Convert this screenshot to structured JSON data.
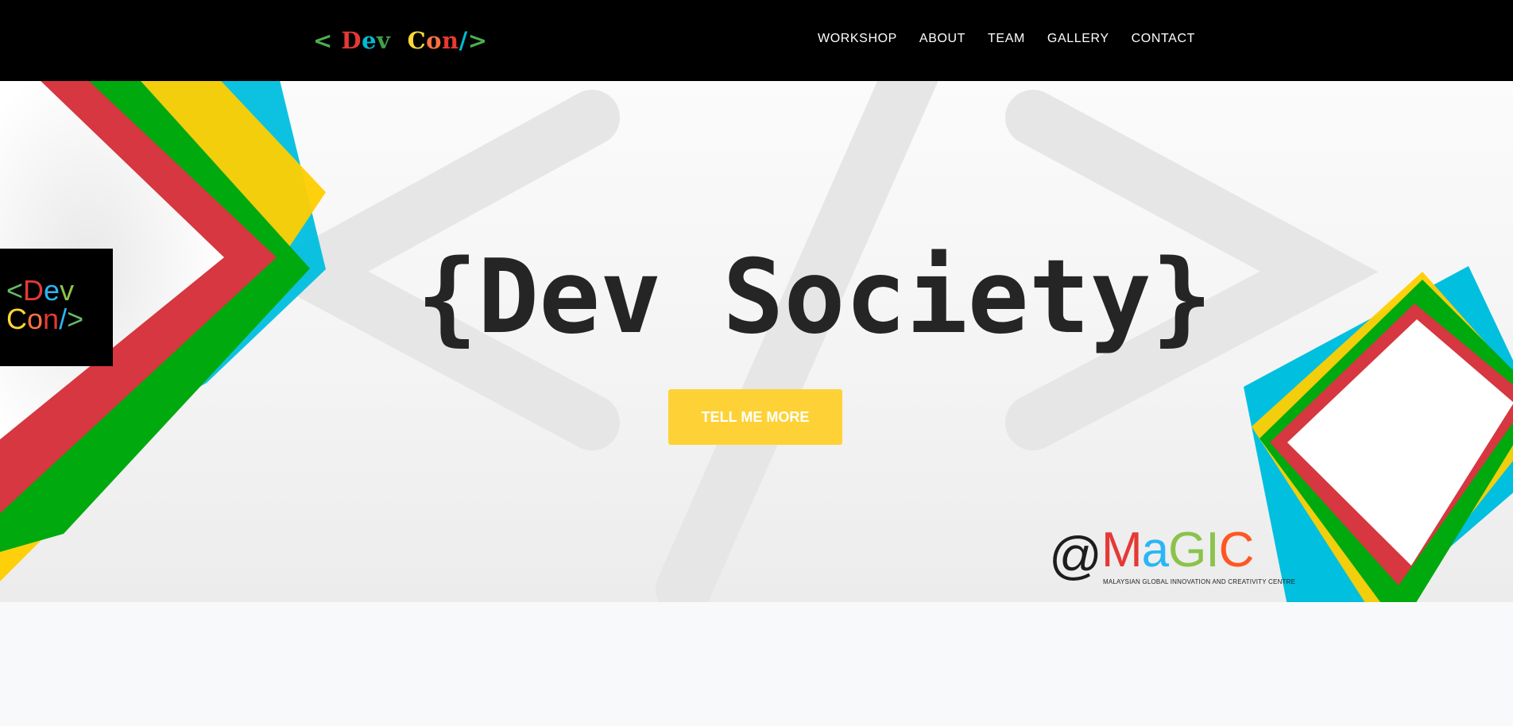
{
  "nav": {
    "brand": {
      "parts": [
        {
          "text": "< ",
          "color": "#4caf50"
        },
        {
          "text": "D",
          "color": "#e53935"
        },
        {
          "text": "e",
          "color": "#00bcd4"
        },
        {
          "text": "v",
          "color": "#43a047"
        },
        {
          "text": "  ",
          "color": "#ffffff"
        },
        {
          "text": "C",
          "color": "#fdd835"
        },
        {
          "text": "o",
          "color": "#ff7043"
        },
        {
          "text": "n",
          "color": "#e53935"
        },
        {
          "text": "/",
          "color": "#00bcd4"
        },
        {
          "text": ">",
          "color": "#4caf50"
        }
      ]
    },
    "items": [
      "WORKSHOP",
      "ABOUT",
      "TEAM",
      "GALLERY",
      "CONTACT"
    ]
  },
  "hero": {
    "title": "{Dev Society}",
    "cta_label": "TELL ME MORE",
    "side_logo": {
      "line1": [
        {
          "text": "<",
          "color": "#66bb6a"
        },
        {
          "text": "D",
          "color": "#e53935"
        },
        {
          "text": "e",
          "color": "#29b6f6"
        },
        {
          "text": "v",
          "color": "#8bc34a"
        }
      ],
      "line2": [
        {
          "text": "C",
          "color": "#fdd835"
        },
        {
          "text": "o",
          "color": "#ff7043"
        },
        {
          "text": "n",
          "color": "#e53935"
        },
        {
          "text": "/",
          "color": "#29b6f6"
        },
        {
          "text": ">",
          "color": "#66bb6a"
        }
      ]
    },
    "sponsor": {
      "at": "@",
      "letters": [
        {
          "text": "M",
          "color": "#e53935"
        },
        {
          "text": "a",
          "color": "#29b6f6"
        },
        {
          "text": "G",
          "color": "#8bc34a"
        },
        {
          "text": "I",
          "color": "#8bc34a"
        },
        {
          "text": "C",
          "color": "#ff5722"
        }
      ],
      "subtitle": "MALAYSIAN GLOBAL INNOVATION AND CREATIVITY CENTRE"
    }
  },
  "colors": {
    "accent": "#fed136",
    "red": "#d63740",
    "green": "#00a90e",
    "blue": "#00bfdf",
    "yellow": "#ffcf00"
  }
}
